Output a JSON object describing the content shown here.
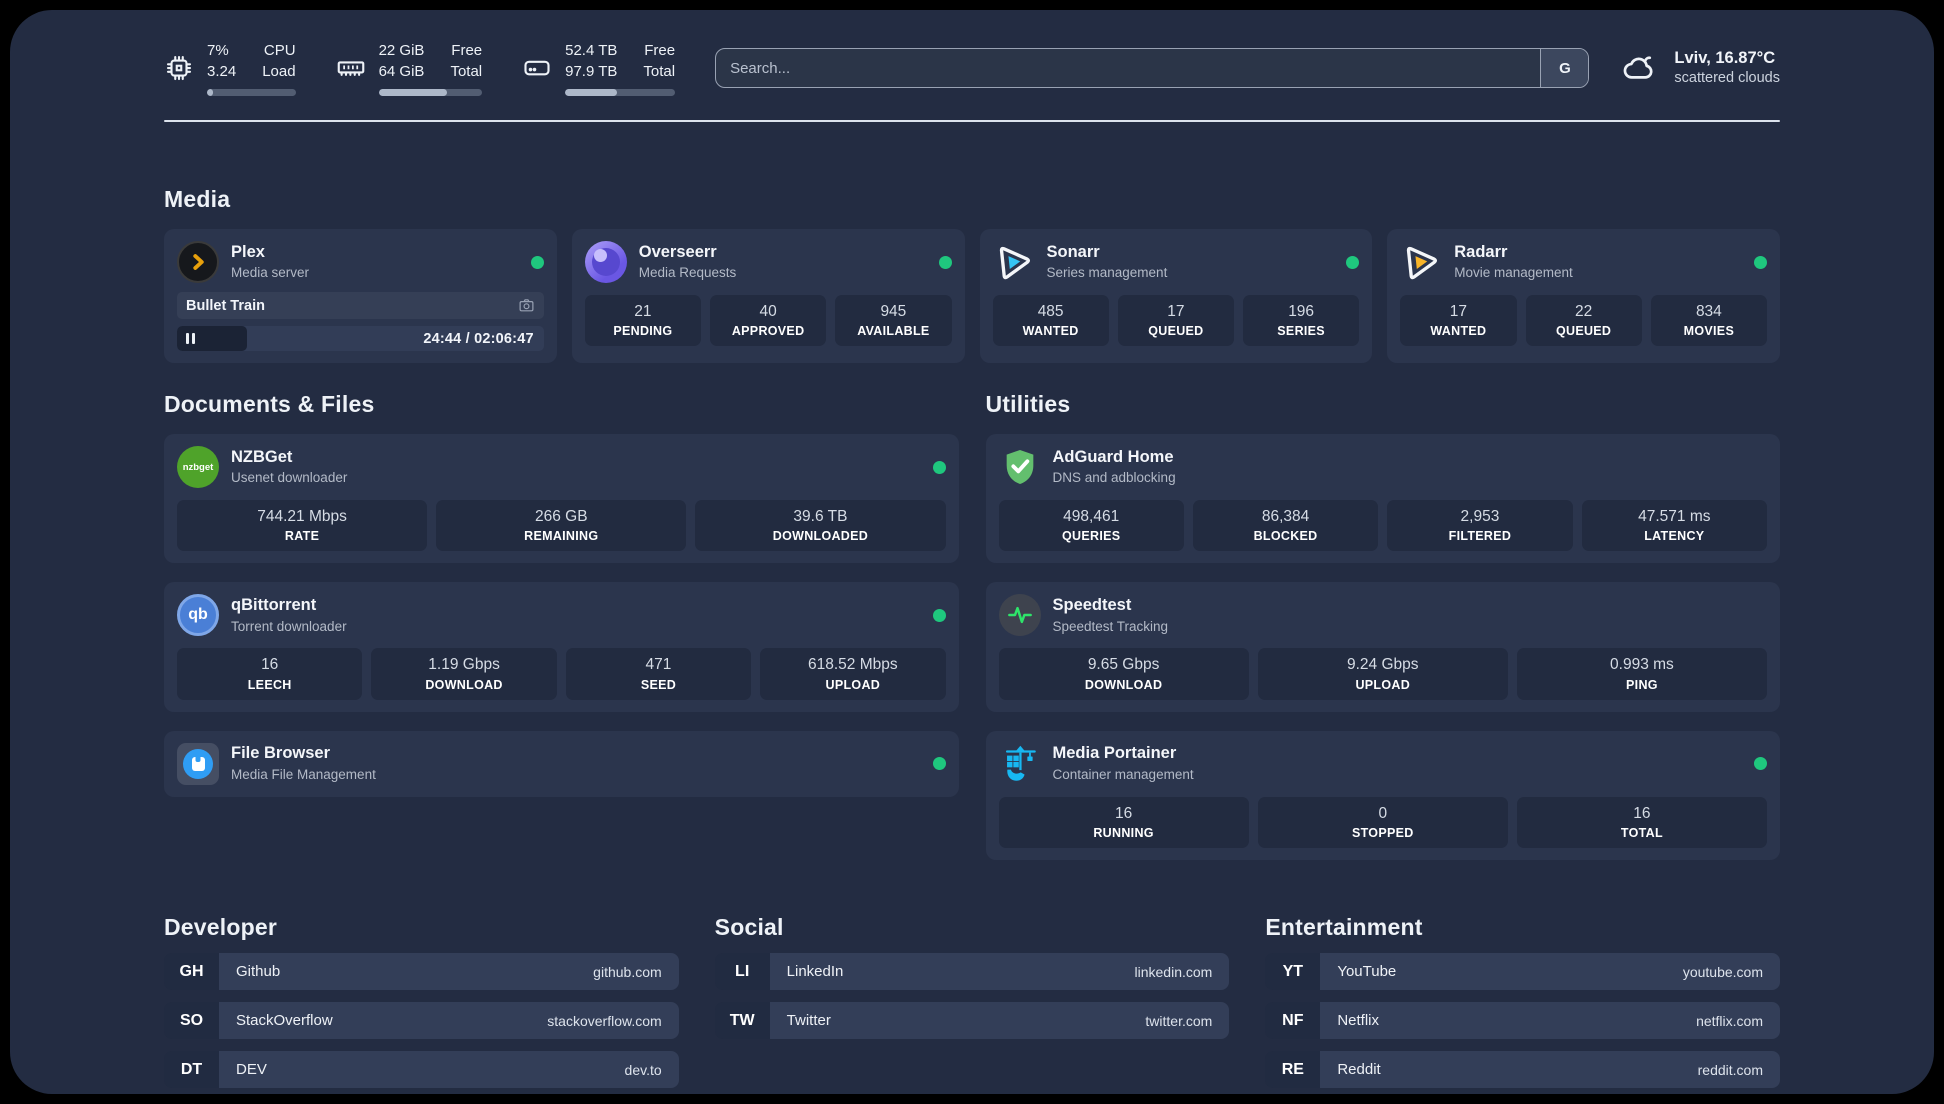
{
  "colors": {
    "accent_green": "#1fc77e",
    "plex_orange": "#e8a00c",
    "sonarr_cyan": "#35c5f4",
    "radarr_yellow": "#f9b529",
    "nzbget_green": "#4fa32a",
    "qbittorrent_blue": "#4a7fd6",
    "adguard_green": "#63bf6e",
    "speedtest_green": "#2ee56a",
    "portainer_blue": "#17b8f2",
    "filebrowser_blue": "#2f9df4"
  },
  "topbar": {
    "stats": [
      {
        "icon": "cpu-icon",
        "values": [
          "7%",
          "3.24"
        ],
        "labels": [
          "CPU",
          "Load"
        ],
        "progress": 7
      },
      {
        "icon": "ram-icon",
        "values": [
          "22 GiB",
          "64 GiB"
        ],
        "labels": [
          "Free",
          "Total"
        ],
        "progress": 66
      },
      {
        "icon": "disk-icon",
        "values": [
          "52.4 TB",
          "97.9 TB"
        ],
        "labels": [
          "Free",
          "Total"
        ],
        "progress": 47
      }
    ],
    "search": {
      "placeholder": "Search...",
      "engine_label": "G"
    },
    "weather": {
      "location": "Lviv, 16.87°C",
      "condition": "scattered clouds"
    }
  },
  "media": {
    "title": "Media",
    "apps": [
      {
        "name": "Plex",
        "desc": "Media server",
        "now_playing": "Bullet Train",
        "time": "24:44 / 02:06:47",
        "progress": 19
      },
      {
        "name": "Overseerr",
        "desc": "Media Requests",
        "stats": [
          {
            "value": "21",
            "label": "PENDING"
          },
          {
            "value": "40",
            "label": "APPROVED"
          },
          {
            "value": "945",
            "label": "AVAILABLE"
          }
        ]
      },
      {
        "name": "Sonarr",
        "desc": "Series management",
        "stats": [
          {
            "value": "485",
            "label": "WANTED"
          },
          {
            "value": "17",
            "label": "QUEUED"
          },
          {
            "value": "196",
            "label": "SERIES"
          }
        ]
      },
      {
        "name": "Radarr",
        "desc": "Movie management",
        "stats": [
          {
            "value": "17",
            "label": "WANTED"
          },
          {
            "value": "22",
            "label": "QUEUED"
          },
          {
            "value": "834",
            "label": "MOVIES"
          }
        ]
      }
    ]
  },
  "documents": {
    "title": "Documents & Files",
    "apps": [
      {
        "name": "NZBGet",
        "desc": "Usenet downloader",
        "icon_text": "nzbget",
        "stats": [
          {
            "value": "744.21 Mbps",
            "label": "RATE"
          },
          {
            "value": "266 GB",
            "label": "REMAINING"
          },
          {
            "value": "39.6 TB",
            "label": "DOWNLOADED"
          }
        ]
      },
      {
        "name": "qBittorrent",
        "desc": "Torrent downloader",
        "icon_text": "qb",
        "stats": [
          {
            "value": "16",
            "label": "LEECH"
          },
          {
            "value": "1.19 Gbps",
            "label": "DOWNLOAD"
          },
          {
            "value": "471",
            "label": "SEED"
          },
          {
            "value": "618.52 Mbps",
            "label": "UPLOAD"
          }
        ]
      },
      {
        "name": "File Browser",
        "desc": "Media File Management"
      }
    ]
  },
  "utilities": {
    "title": "Utilities",
    "apps": [
      {
        "name": "AdGuard Home",
        "desc": "DNS and adblocking",
        "stats": [
          {
            "value": "498,461",
            "label": "QUERIES"
          },
          {
            "value": "86,384",
            "label": "BLOCKED"
          },
          {
            "value": "2,953",
            "label": "FILTERED"
          },
          {
            "value": "47.571 ms",
            "label": "LATENCY"
          }
        ]
      },
      {
        "name": "Speedtest",
        "desc": "Speedtest Tracking",
        "stats": [
          {
            "value": "9.65 Gbps",
            "label": "DOWNLOAD"
          },
          {
            "value": "9.24 Gbps",
            "label": "UPLOAD"
          },
          {
            "value": "0.993 ms",
            "label": "PING"
          }
        ]
      },
      {
        "name": "Media Portainer",
        "desc": "Container management",
        "stats": [
          {
            "value": "16",
            "label": "RUNNING"
          },
          {
            "value": "0",
            "label": "STOPPED"
          },
          {
            "value": "16",
            "label": "TOTAL"
          }
        ]
      }
    ]
  },
  "bookmarks": [
    {
      "title": "Developer",
      "items": [
        {
          "abbr": "GH",
          "name": "Github",
          "url": "github.com"
        },
        {
          "abbr": "SO",
          "name": "StackOverflow",
          "url": "stackoverflow.com"
        },
        {
          "abbr": "DT",
          "name": "DEV",
          "url": "dev.to"
        }
      ]
    },
    {
      "title": "Social",
      "items": [
        {
          "abbr": "LI",
          "name": "LinkedIn",
          "url": "linkedin.com"
        },
        {
          "abbr": "TW",
          "name": "Twitter",
          "url": "twitter.com"
        }
      ]
    },
    {
      "title": "Entertainment",
      "items": [
        {
          "abbr": "YT",
          "name": "YouTube",
          "url": "youtube.com"
        },
        {
          "abbr": "NF",
          "name": "Netflix",
          "url": "netflix.com"
        },
        {
          "abbr": "RE",
          "name": "Reddit",
          "url": "reddit.com"
        }
      ]
    }
  ]
}
